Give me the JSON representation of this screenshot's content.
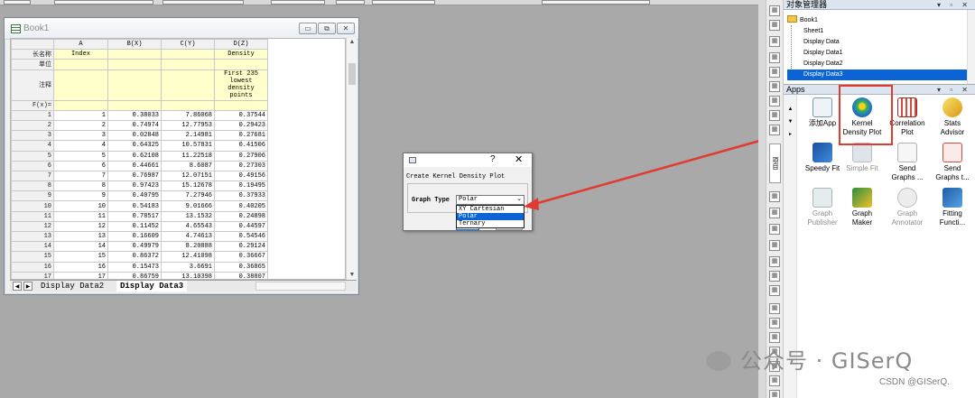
{
  "book": {
    "title": "Book1",
    "columns": [
      "A",
      "B(X)",
      "C(Y)",
      "D(Z)"
    ],
    "meta_rows": [
      {
        "label": "长名称",
        "cells": [
          "Index",
          "",
          "",
          "Density"
        ]
      },
      {
        "label": "单位",
        "cells": [
          "",
          "",
          "",
          ""
        ]
      },
      {
        "label": "注释",
        "cells": [
          "",
          "",
          "",
          "First 235 lowest density points"
        ]
      },
      {
        "label": "F(x)=",
        "cells": [
          "",
          "",
          "",
          ""
        ]
      }
    ],
    "rows": [
      [
        "1",
        "1",
        "0.38033",
        "7.86068",
        "0.37544"
      ],
      [
        "2",
        "2",
        "0.74974",
        "12.77953",
        "0.29423"
      ],
      [
        "3",
        "3",
        "0.02848",
        "2.14981",
        "0.27681"
      ],
      [
        "4",
        "4",
        "0.64325",
        "10.57831",
        "0.41506"
      ],
      [
        "5",
        "5",
        "0.62108",
        "11.22518",
        "0.27906"
      ],
      [
        "6",
        "6",
        "0.44661",
        "8.6087",
        "0.27303"
      ],
      [
        "7",
        "7",
        "0.76987",
        "12.07151",
        "0.49156"
      ],
      [
        "8",
        "8",
        "0.97423",
        "15.12678",
        "0.19495"
      ],
      [
        "9",
        "9",
        "0.40795",
        "7.27946",
        "0.37933"
      ],
      [
        "10",
        "10",
        "0.54183",
        "9.01666",
        "0.40205"
      ],
      [
        "11",
        "11",
        "0.78517",
        "13.1532",
        "0.24898"
      ],
      [
        "12",
        "12",
        "0.11452",
        "4.65543",
        "0.44597"
      ],
      [
        "13",
        "13",
        "0.16609",
        "4.74613",
        "0.54546"
      ],
      [
        "14",
        "14",
        "0.49979",
        "8.20888",
        "0.29124"
      ],
      [
        "15",
        "15",
        "0.86372",
        "12.41098",
        "0.36667"
      ],
      [
        "16",
        "16",
        "0.15473",
        "3.6691",
        "0.36865"
      ],
      [
        "17",
        "17",
        "0.86759",
        "13.10398",
        "0.38807"
      ]
    ],
    "tabs": [
      "Display Data2",
      "Display Data3"
    ],
    "active_tab": "Display Data3"
  },
  "dialog": {
    "help": "?",
    "close": "✕",
    "heading": "Create Kernel Density Plot",
    "graph_type_label": "Graph Type",
    "selected": "Polar",
    "options": [
      "XY Cartesian",
      "Polar",
      "Ternary"
    ],
    "highlighted": "Polar",
    "ok_label": "OK",
    "cancel_label": "Cancel"
  },
  "object_manager": {
    "title": "对象管理器",
    "controls": "▾ ▫ ✕",
    "root": "Book1",
    "children": [
      "Sheet1",
      "Display Data",
      "Display Data1",
      "Display Data2",
      "Display Data3"
    ],
    "selected": "Display Data3"
  },
  "apps": {
    "title": "Apps",
    "controls": "▾ ▫ ✕",
    "items": [
      {
        "name": "add-app",
        "label1": "添加App",
        "label2": "",
        "enabled": true
      },
      {
        "name": "kernel-density-plot",
        "label1": "Kernel",
        "label2": "Density Plot",
        "enabled": true
      },
      {
        "name": "correlation-plot",
        "label1": "Correlation",
        "label2": "Plot",
        "enabled": true
      },
      {
        "name": "stats-advisor",
        "label1": "Stats",
        "label2": "Advisor",
        "enabled": true
      },
      {
        "name": "speedy-fit",
        "label1": "Speedy Fit",
        "label2": "",
        "enabled": true
      },
      {
        "name": "simple-fit",
        "label1": "Simple Fit",
        "label2": "",
        "enabled": false
      },
      {
        "name": "send-graphs",
        "label1": "Send",
        "label2": "Graphs ...",
        "enabled": true
      },
      {
        "name": "send-graphs-t",
        "label1": "Send",
        "label2": "Graphs t...",
        "enabled": true
      },
      {
        "name": "graph-publisher",
        "label1": "Graph",
        "label2": "Publisher",
        "enabled": false
      },
      {
        "name": "graph-maker",
        "label1": "Graph",
        "label2": "Maker",
        "enabled": true
      },
      {
        "name": "graph-annotator",
        "label1": "Graph",
        "label2": "Annotator",
        "enabled": false
      },
      {
        "name": "fitting-function",
        "label1": "Fitting",
        "label2": "Functi...",
        "enabled": true
      }
    ],
    "side_tab": "项目"
  },
  "watermark": {
    "text": "公众号 · GISerQ",
    "csdn": "CSDN @GISerQ."
  },
  "colors": {
    "annotation_red": "#e23a2f",
    "selection_blue": "#0a64d6",
    "meta_yellow": "#ffffcc"
  }
}
